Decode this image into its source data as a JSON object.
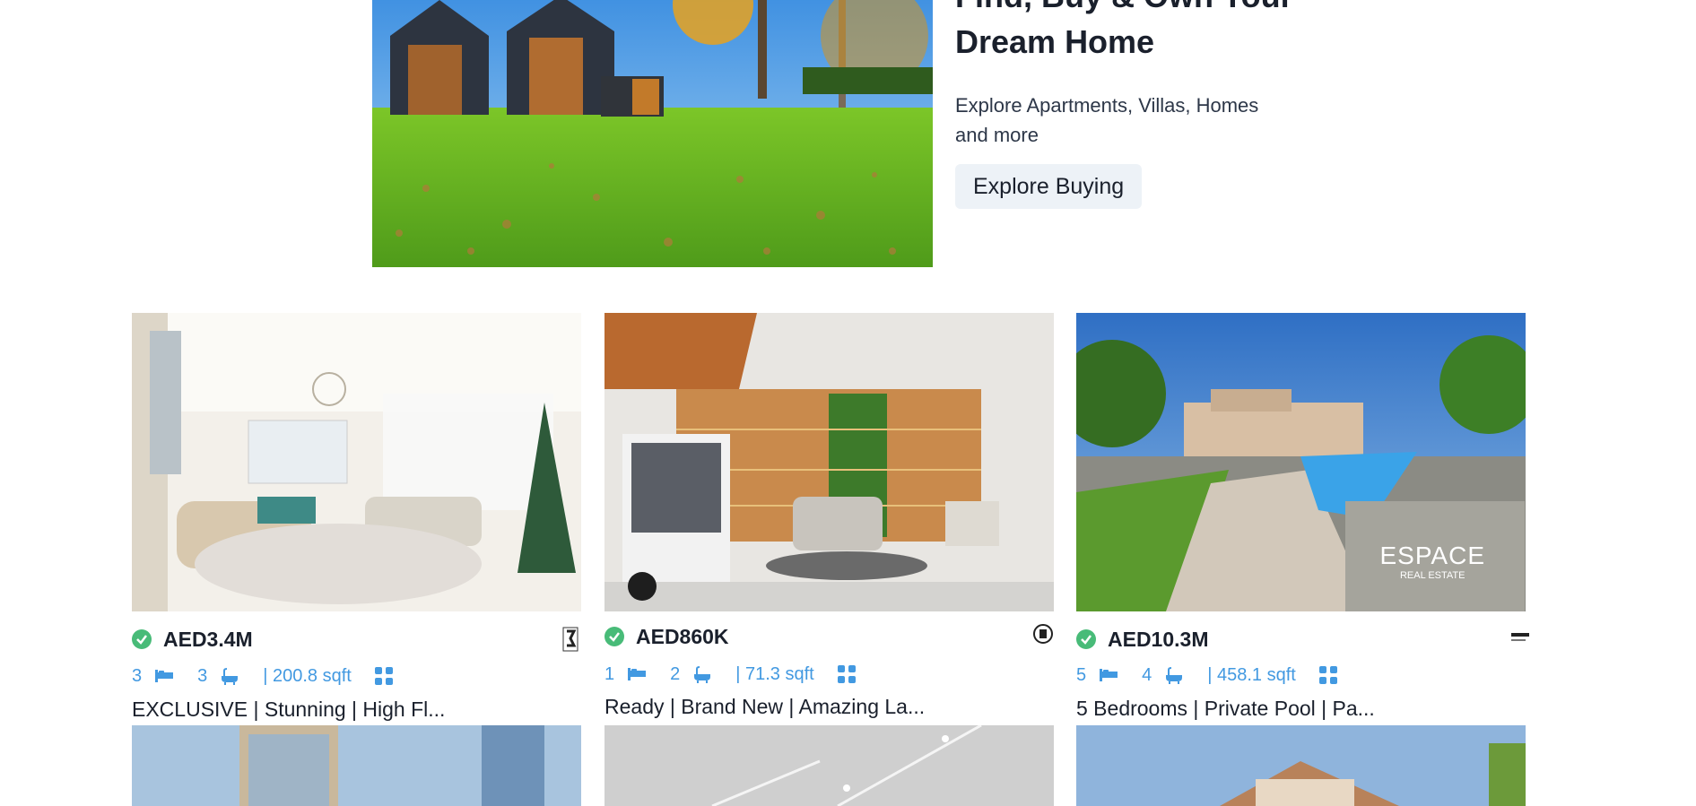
{
  "hero": {
    "title": "Find, Buy & Own Your Dream Home",
    "subtitle": "Explore Apartments, Villas, Homes and more",
    "button_label": "Explore Buying"
  },
  "listings": [
    {
      "verified": true,
      "price": "AED3.4M",
      "beds": "3",
      "baths": "3",
      "area": "| 200.8 sqft",
      "title": "EXCLUSIVE | Stunning | High Fl..."
    },
    {
      "verified": true,
      "price": "AED860K",
      "beds": "1",
      "baths": "2",
      "area": "| 71.3 sqft",
      "title": "Ready | Brand New | Amazing La..."
    },
    {
      "verified": true,
      "price": "AED10.3M",
      "beds": "5",
      "baths": "4",
      "area": "| 458.1 sqft",
      "title": "5 Bedrooms | Private Pool | Pa...",
      "watermark": "ESPACE",
      "watermark_sub": "REAL ESTATE"
    }
  ],
  "colors": {
    "accent": "#4299e1",
    "verified": "#48bb78",
    "button_bg": "#edf2f7",
    "text": "#1a202c"
  },
  "icons": [
    "check-circle-icon",
    "bed-icon",
    "bath-icon",
    "grid-icon"
  ]
}
